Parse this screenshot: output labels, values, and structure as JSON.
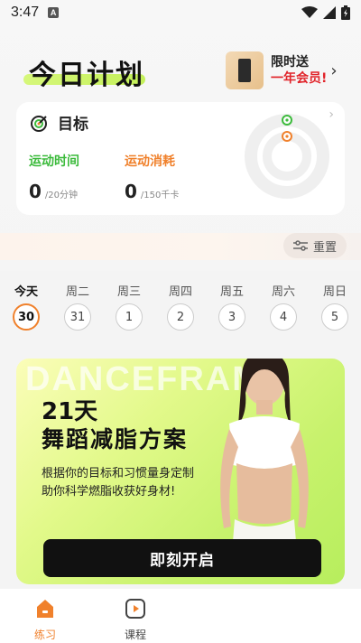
{
  "status_bar": {
    "time": "3:47",
    "notif_icon": "A"
  },
  "header": {
    "title": "今日计划"
  },
  "vip_banner": {
    "line1": "限时送",
    "line2": "一年会员!"
  },
  "goal_card": {
    "title": "目标",
    "exercise_time": {
      "label": "运动时间",
      "value": "0",
      "unit": "/20分钟",
      "color": "#3dbb3d"
    },
    "exercise_burn": {
      "label": "运动消耗",
      "value": "0",
      "unit": "/150千卡",
      "color": "#f0812c"
    }
  },
  "reset": {
    "label": "重置"
  },
  "week": [
    {
      "label": "今天",
      "date": "30",
      "today": true
    },
    {
      "label": "周二",
      "date": "31"
    },
    {
      "label": "周三",
      "date": "1"
    },
    {
      "label": "周四",
      "date": "2"
    },
    {
      "label": "周五",
      "date": "3"
    },
    {
      "label": "周六",
      "date": "4"
    },
    {
      "label": "周日",
      "date": "5"
    }
  ],
  "promo": {
    "watermark": "DANCEFRAME",
    "title_line1": "21天",
    "title_line2": "舞蹈减脂方案",
    "desc_line1": "根据你的目标和习惯量身定制",
    "desc_line2": "助你科学燃脂收获好身材!",
    "button": "即刻开启"
  },
  "tabs": [
    {
      "label": "练习",
      "icon": "home-icon",
      "active": true
    },
    {
      "label": "课程",
      "icon": "play-icon",
      "active": false
    }
  ],
  "colors": {
    "accent": "#f0812c",
    "green": "#3dbb3d",
    "lime": "#c7f26c"
  }
}
